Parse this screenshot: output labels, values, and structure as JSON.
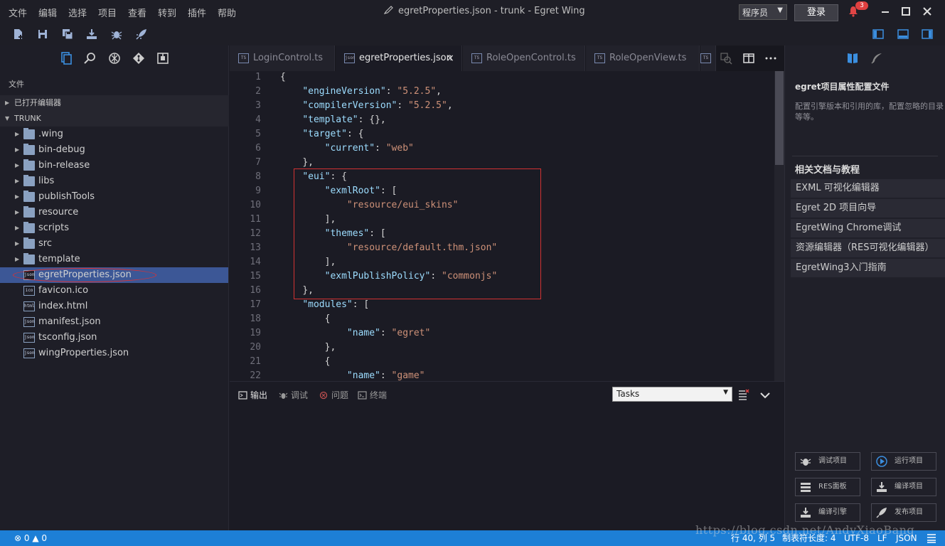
{
  "menu": [
    "文件",
    "编辑",
    "选择",
    "项目",
    "查看",
    "转到",
    "插件",
    "帮助"
  ],
  "window_title": "egretProperties.json - trunk - Egret Wing",
  "account": {
    "role": "程序员",
    "login": "登录",
    "notifications": "3"
  },
  "toolbar_icons": [
    "new-file-icon",
    "save-icon",
    "save-all-icon",
    "build-icon",
    "debug-icon",
    "publish-icon"
  ],
  "sidebar": {
    "files_label": "文件",
    "open_editors": "已打开编辑器",
    "root": "TRUNK",
    "tree": [
      {
        "label": ".wing",
        "kind": "folder"
      },
      {
        "label": "bin-debug",
        "kind": "folder"
      },
      {
        "label": "bin-release",
        "kind": "folder"
      },
      {
        "label": "libs",
        "kind": "folder"
      },
      {
        "label": "publishTools",
        "kind": "folder"
      },
      {
        "label": "resource",
        "kind": "folder"
      },
      {
        "label": "scripts",
        "kind": "folder"
      },
      {
        "label": "src",
        "kind": "folder"
      },
      {
        "label": "template",
        "kind": "folder"
      },
      {
        "label": "egretProperties.json",
        "kind": "json",
        "selected": true
      },
      {
        "label": "favicon.ico",
        "kind": "ico"
      },
      {
        "label": "index.html",
        "kind": "html"
      },
      {
        "label": "manifest.json",
        "kind": "json"
      },
      {
        "label": "tsconfig.json",
        "kind": "json"
      },
      {
        "label": "wingProperties.json",
        "kind": "json"
      }
    ]
  },
  "tabs": [
    {
      "label": "LoginControl.ts",
      "badge": "TS"
    },
    {
      "label": "egretProperties.json",
      "badge": "json",
      "active": true,
      "close": "×"
    },
    {
      "label": "RoleOpenControl.ts",
      "badge": "TS"
    },
    {
      "label": "RoleOpenView.ts",
      "badge": "TS"
    },
    {
      "label": "",
      "badge": "TS"
    }
  ],
  "editor": {
    "line_numbers": [
      "1",
      "2",
      "3",
      "4",
      "5",
      "6",
      "7",
      "8",
      "9",
      "10",
      "11",
      "12",
      "13",
      "14",
      "15",
      "16",
      "17",
      "18",
      "19",
      "20",
      "21",
      "22"
    ]
  },
  "panel": {
    "tabs": [
      "输出",
      "调试",
      "问题",
      "终端"
    ],
    "task_select": "Tasks"
  },
  "right_panel": {
    "title": "egret项目属性配置文件",
    "desc": "配置引擎版本和引用的库，配置忽略的目录等等。",
    "docs_header": "相关文档与教程",
    "docs": [
      "EXML 可视化编辑器",
      "Egret 2D 项目向导",
      "EgretWing Chrome调试",
      "资源编辑器（RES可视化编辑器）",
      "EgretWing3入门指南"
    ],
    "actions": [
      "调试项目",
      "运行项目",
      "RES面板",
      "编译项目",
      "编译引擎",
      "发布项目"
    ]
  },
  "status": {
    "errors": "0",
    "warnings": "0",
    "cursor": "行 40, 列 5",
    "tab_size": "制表符长度: 4",
    "encoding": "UTF-8",
    "eol": "LF",
    "language": "JSON"
  },
  "watermark": "https://blog.csdn.net/AndyXiaoBang"
}
